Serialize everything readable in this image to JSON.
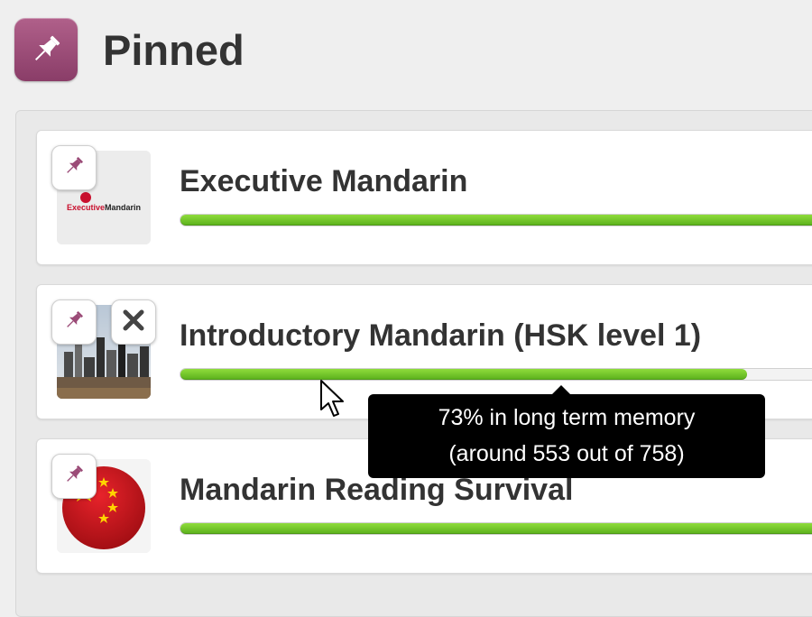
{
  "header": {
    "title": "Pinned",
    "icon": "pushpin-icon",
    "accent_color": "#9b4b77"
  },
  "courses": [
    {
      "title": "Executive Mandarin",
      "thumbnail_text": "ExecutiveMandarin",
      "progress": 1.0,
      "pin_icon": "pushpin-icon",
      "pinned": true
    },
    {
      "title": "Introductory Mandarin (HSK level 1)",
      "progress": 0.73,
      "pin_icon": "pushpin-icon",
      "close_icon": "close-icon",
      "pinned": true
    },
    {
      "title": "Mandarin Reading Survival",
      "progress": 1.0,
      "pin_icon": "pushpin-icon",
      "pinned": true
    }
  ],
  "tooltip": {
    "line1": "73% in long term memory",
    "line2": "(around 553 out of 758)"
  },
  "colors": {
    "progress_green": "#6cc42a",
    "tooltip_bg": "#000000"
  }
}
